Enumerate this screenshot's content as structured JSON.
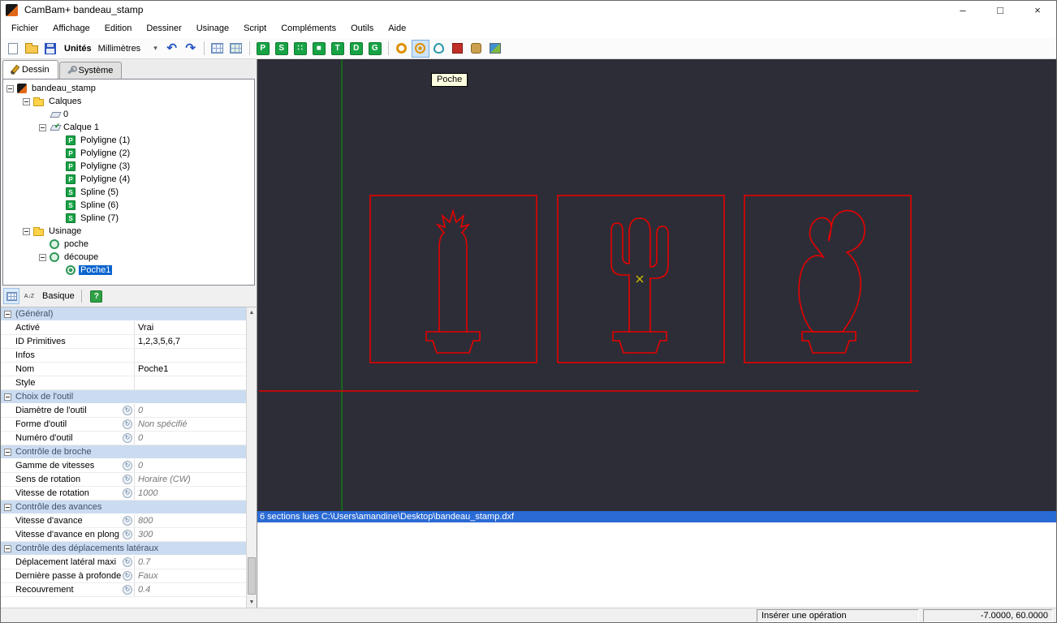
{
  "colors": {
    "canvas_bg": "#2d2d37",
    "drawing_red": "#e60000",
    "axis_green": "#00a000",
    "selection_blue": "#0a64ce",
    "marker_yellow": "#c8b800",
    "section_bg": "#cbdcf0",
    "status_message_bg": "#2a6ad4"
  },
  "window": {
    "title": "CamBam+  bandeau_stamp",
    "controls": {
      "minimize": "–",
      "maximize": "□",
      "close": "×"
    }
  },
  "menu": {
    "items": [
      "Fichier",
      "Affichage",
      "Edition",
      "Dessiner",
      "Usinage",
      "Script",
      "Compléments",
      "Outils",
      "Aide"
    ]
  },
  "toolbar": {
    "unites_label": "Unités",
    "units_value": "Millimètres",
    "icons": [
      {
        "name": "new-file-icon",
        "kind": "new"
      },
      {
        "name": "open-folder-icon",
        "kind": "open"
      },
      {
        "name": "save-icon",
        "kind": "save"
      },
      {
        "name": "units-label",
        "kind": "label"
      },
      {
        "name": "units-combo",
        "kind": "combo"
      },
      {
        "name": "undo-icon",
        "kind": "undo",
        "glyph": "↶"
      },
      {
        "name": "redo-icon",
        "kind": "redo",
        "glyph": "↷"
      },
      {
        "kind": "sep"
      },
      {
        "name": "grid-snap-icon",
        "kind": "grid1"
      },
      {
        "name": "grid-table-icon",
        "kind": "grid2"
      },
      {
        "kind": "sep"
      },
      {
        "name": "draw-polyline-icon",
        "kind": "green",
        "glyph": "P"
      },
      {
        "name": "draw-spline-icon",
        "kind": "green",
        "glyph": "S"
      },
      {
        "name": "draw-points-icon",
        "kind": "green",
        "glyph": "∷"
      },
      {
        "name": "draw-rectangle-icon",
        "kind": "green",
        "glyph": "■"
      },
      {
        "name": "draw-text-icon",
        "kind": "green",
        "glyph": "T"
      },
      {
        "name": "draw-surface-icon",
        "kind": "green",
        "glyph": "D"
      },
      {
        "name": "draw-region-icon",
        "kind": "green",
        "glyph": "G"
      },
      {
        "kind": "sep"
      },
      {
        "name": "mop-drill-icon",
        "kind": "mop-drill"
      },
      {
        "name": "mop-pocket-icon",
        "kind": "mop-pocket",
        "hover": true
      },
      {
        "name": "mop-profile-icon",
        "kind": "mop-profile"
      },
      {
        "name": "mop-engrave-icon",
        "kind": "mop-engrave"
      },
      {
        "name": "mop-lathe-icon",
        "kind": "mop-lathe"
      },
      {
        "name": "mop-3d-icon",
        "kind": "mop-3d"
      }
    ]
  },
  "panel_tabs": [
    {
      "label": "Dessin",
      "icon": "pencil-icon",
      "active": true
    },
    {
      "label": "Système",
      "icon": "wrench-icon",
      "active": false
    }
  ],
  "tree": {
    "items": [
      {
        "indent": 0,
        "expand": "minus",
        "icon": "cambam-file-icon",
        "label": "bandeau_stamp"
      },
      {
        "indent": 1,
        "expand": "minus",
        "icon": "folder-icon",
        "label": "Calques"
      },
      {
        "indent": 2,
        "expand": "none",
        "icon": "layer-icon",
        "label": "0"
      },
      {
        "indent": 2,
        "expand": "minus",
        "icon": "layer-checked-icon",
        "label": "Calque 1"
      },
      {
        "indent": 3,
        "expand": "none",
        "icon": "polyline-icon",
        "label": "Polyligne (1)"
      },
      {
        "indent": 3,
        "expand": "none",
        "icon": "polyline-icon",
        "label": "Polyligne (2)"
      },
      {
        "indent": 3,
        "expand": "none",
        "icon": "polyline-icon",
        "label": "Polyligne (3)"
      },
      {
        "indent": 3,
        "expand": "none",
        "icon": "polyline-icon",
        "label": "Polyligne (4)"
      },
      {
        "indent": 3,
        "expand": "none",
        "icon": "spline-icon",
        "label": "Spline (5)"
      },
      {
        "indent": 3,
        "expand": "none",
        "icon": "spline-icon",
        "label": "Spline (6)"
      },
      {
        "indent": 3,
        "expand": "none",
        "icon": "spline-icon",
        "label": "Spline (7)"
      },
      {
        "indent": 1,
        "expand": "minus",
        "icon": "folder-icon",
        "label": "Usinage"
      },
      {
        "indent": 2,
        "expand": "none",
        "icon": "machining-icon",
        "label": "poche"
      },
      {
        "indent": 2,
        "expand": "minus",
        "icon": "machining-icon",
        "label": "découpe"
      },
      {
        "indent": 3,
        "expand": "none",
        "icon": "pocket-op-icon",
        "label": "Poche1",
        "selected": true
      }
    ]
  },
  "properties": {
    "toolbar": {
      "view_label": "Basique",
      "help_icon": "?",
      "sort_icon": "A↓Z"
    },
    "rows": [
      {
        "type": "section",
        "name": "(Général)"
      },
      {
        "type": "row",
        "name": "Activé",
        "value": "Vrai"
      },
      {
        "type": "row",
        "name": "ID Primitives",
        "value": "1,2,3,5,6,7"
      },
      {
        "type": "row",
        "name": "Infos",
        "value": ""
      },
      {
        "type": "row",
        "name": "Nom",
        "value": "Poche1"
      },
      {
        "type": "row",
        "name": "Style",
        "value": ""
      },
      {
        "type": "section",
        "name": "Choix de l'outil"
      },
      {
        "type": "row",
        "name": "Diamètre de l'outil",
        "value": "0",
        "italic": true,
        "icon": true
      },
      {
        "type": "row",
        "name": "Forme d'outil",
        "value": "Non spécifié",
        "italic": true,
        "icon": true
      },
      {
        "type": "row",
        "name": "Numéro d'outil",
        "value": "0",
        "italic": true,
        "icon": true
      },
      {
        "type": "section",
        "name": "Contrôle de broche"
      },
      {
        "type": "row",
        "name": "Gamme de vitesses",
        "value": "0",
        "italic": true,
        "icon": true
      },
      {
        "type": "row",
        "name": "Sens de rotation",
        "value": "Horaire (CW)",
        "italic": true,
        "icon": true
      },
      {
        "type": "row",
        "name": "Vitesse de rotation",
        "value": "1000",
        "italic": true,
        "icon": true
      },
      {
        "type": "section",
        "name": "Contrôle des avances"
      },
      {
        "type": "row",
        "name": "Vitesse d'avance",
        "value": "800",
        "italic": true,
        "icon": true
      },
      {
        "type": "row",
        "name": "Vitesse d'avance en plong",
        "value": "300",
        "italic": true,
        "icon": true
      },
      {
        "type": "section",
        "name": "Contrôle des déplacements latéraux"
      },
      {
        "type": "row",
        "name": "Déplacement latéral maxi",
        "value": "0.7",
        "italic": true,
        "icon": true
      },
      {
        "type": "row",
        "name": "Dernière passe à profonde",
        "value": "Faux",
        "italic": true,
        "icon": true
      },
      {
        "type": "row",
        "name": "Recouvrement",
        "value": "0.4",
        "italic": true,
        "icon": true
      }
    ]
  },
  "canvas": {
    "tooltip": "Poche"
  },
  "status": {
    "message": "6 sections lues C:\\Users\\amandine\\Desktop\\bandeau_stamp.dxf",
    "hint": "Insérer une opération",
    "coordinates": "-7.0000, 60.0000"
  }
}
